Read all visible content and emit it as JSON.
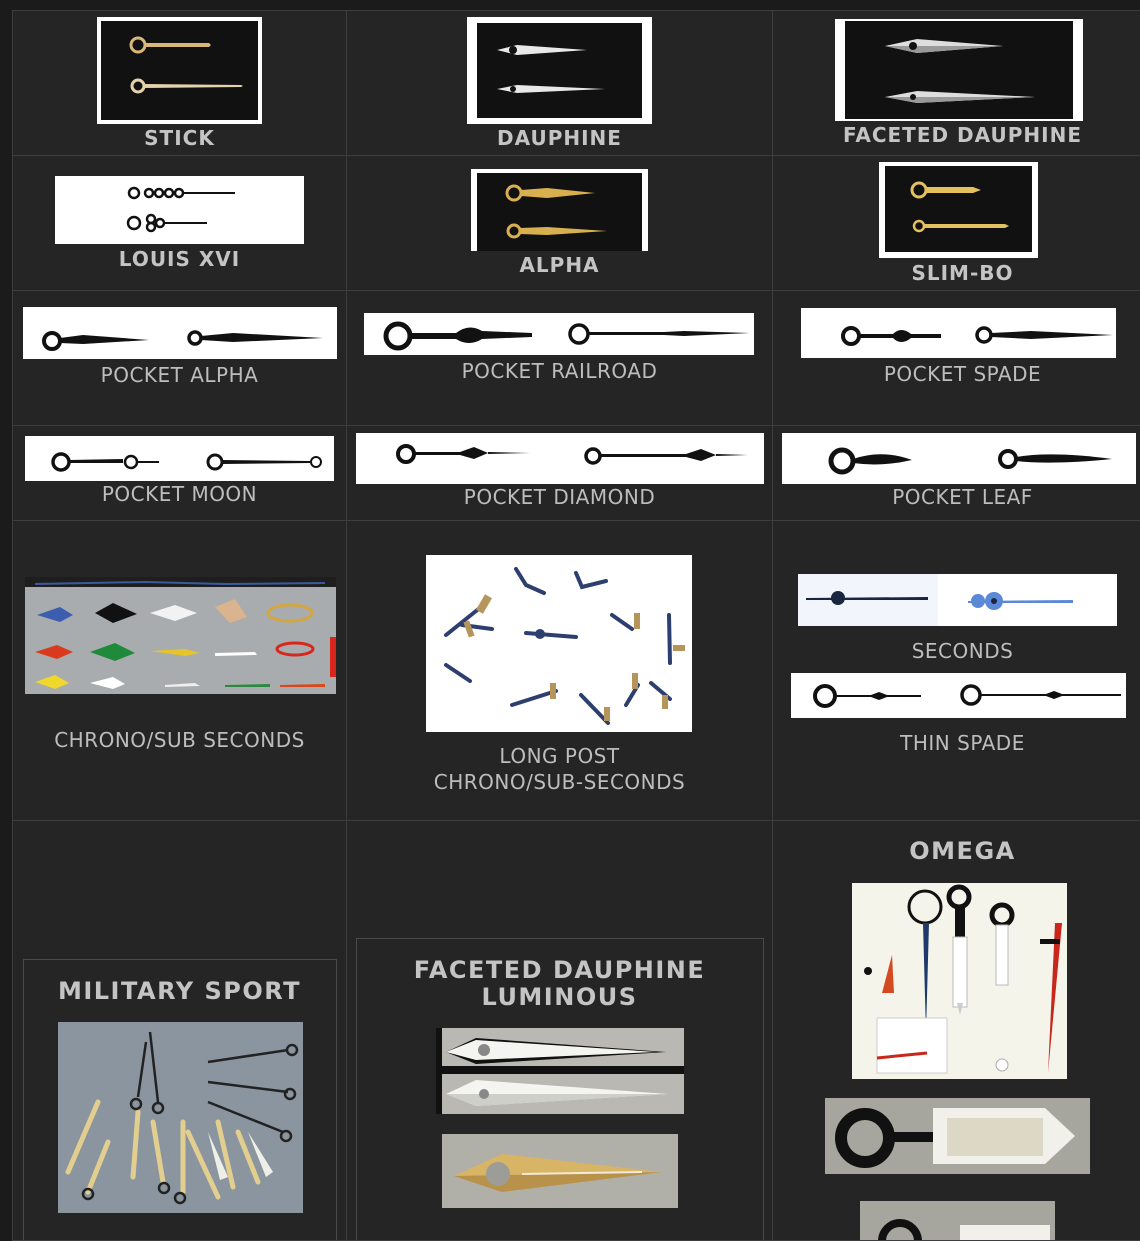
{
  "items": {
    "stick": "STICK",
    "dauphine": "DAUPHINE",
    "faceted_dauphine": "FACETED DAUPHINE",
    "louis_xvi": "LOUIS XVI",
    "alpha": "ALPHA",
    "slim_bo": "SLIM-BO",
    "pocket_alpha": "POCKET ALPHA",
    "pocket_railroad": "POCKET RAILROAD",
    "pocket_spade": "POCKET SPADE",
    "pocket_moon": "POCKET MOON",
    "pocket_diamond": "POCKET DIAMOND",
    "pocket_leaf": "POCKET LEAF",
    "chrono_sub_seconds": "CHRONO/SUB SECONDS",
    "long_post_line1": "LONG POST",
    "long_post_line2": "CHRONO/SUB-SECONDS",
    "seconds": "SECONDS",
    "thin_spade": "THIN SPADE",
    "military_sport": "MILITARY SPORT",
    "faceted_dauphine_luminous_line1": "FACETED DAUPHINE",
    "faceted_dauphine_luminous_line2": "LUMINOUS",
    "omega": "OMEGA"
  },
  "colors": {
    "page_bg": "#1b1b1b",
    "cell_bg": "#252525",
    "grid_line": "#3e3e3e",
    "label": "#bdbdbd"
  }
}
